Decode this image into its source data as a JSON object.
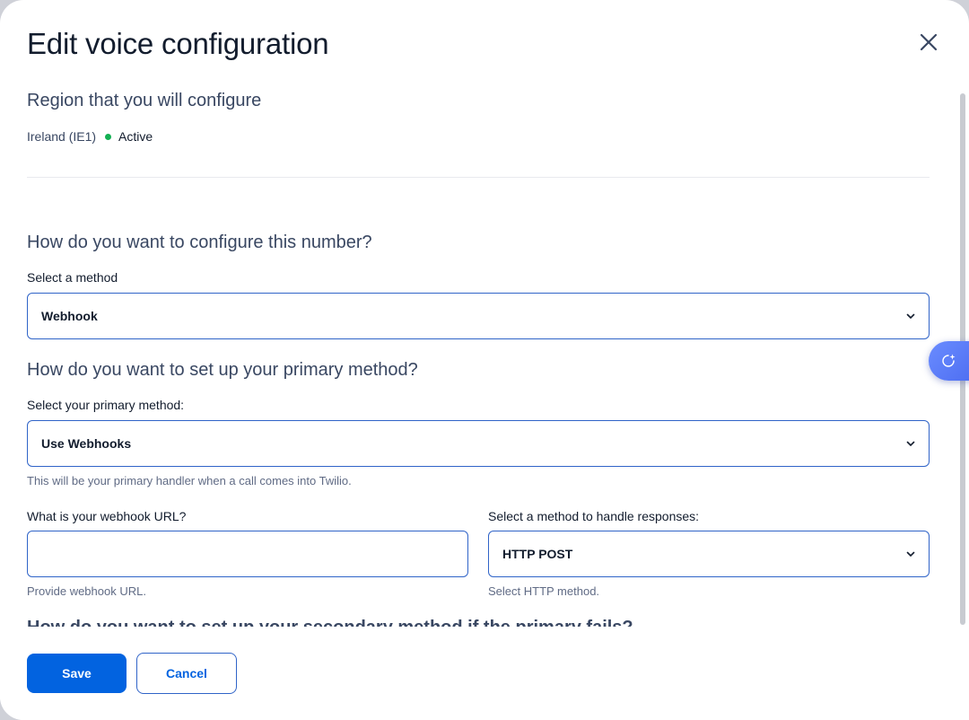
{
  "modal": {
    "title": "Edit voice configuration"
  },
  "region": {
    "heading": "Region that you will configure",
    "name": "Ireland (IE1)",
    "status": "Active",
    "status_color": "#14b053"
  },
  "configure": {
    "heading": "How do you want to configure this number?",
    "method_label": "Select a method",
    "method_value": "Webhook"
  },
  "primary": {
    "heading": "How do you want to set up your primary method?",
    "method_label": "Select your primary method:",
    "method_value": "Use Webhooks",
    "method_help": "This will be your primary handler when a call comes into Twilio.",
    "url_label": "What is your webhook URL?",
    "url_value": "",
    "url_help": "Provide webhook URL.",
    "http_label": "Select a method to handle responses:",
    "http_value": "HTTP POST",
    "http_help": "Select HTTP method."
  },
  "secondary": {
    "heading_partial": "How do you want to set up your secondary method if the primary fails?"
  },
  "footer": {
    "save_label": "Save",
    "cancel_label": "Cancel"
  },
  "colors": {
    "accent": "#0263e0",
    "border_focus": "#3064c8",
    "heading": "#394762",
    "text": "#121c2d",
    "help": "#606b85"
  },
  "icons": {
    "close": "close-icon",
    "chevron": "chevron-down-icon",
    "assistant": "sparkle-assistant-icon"
  }
}
